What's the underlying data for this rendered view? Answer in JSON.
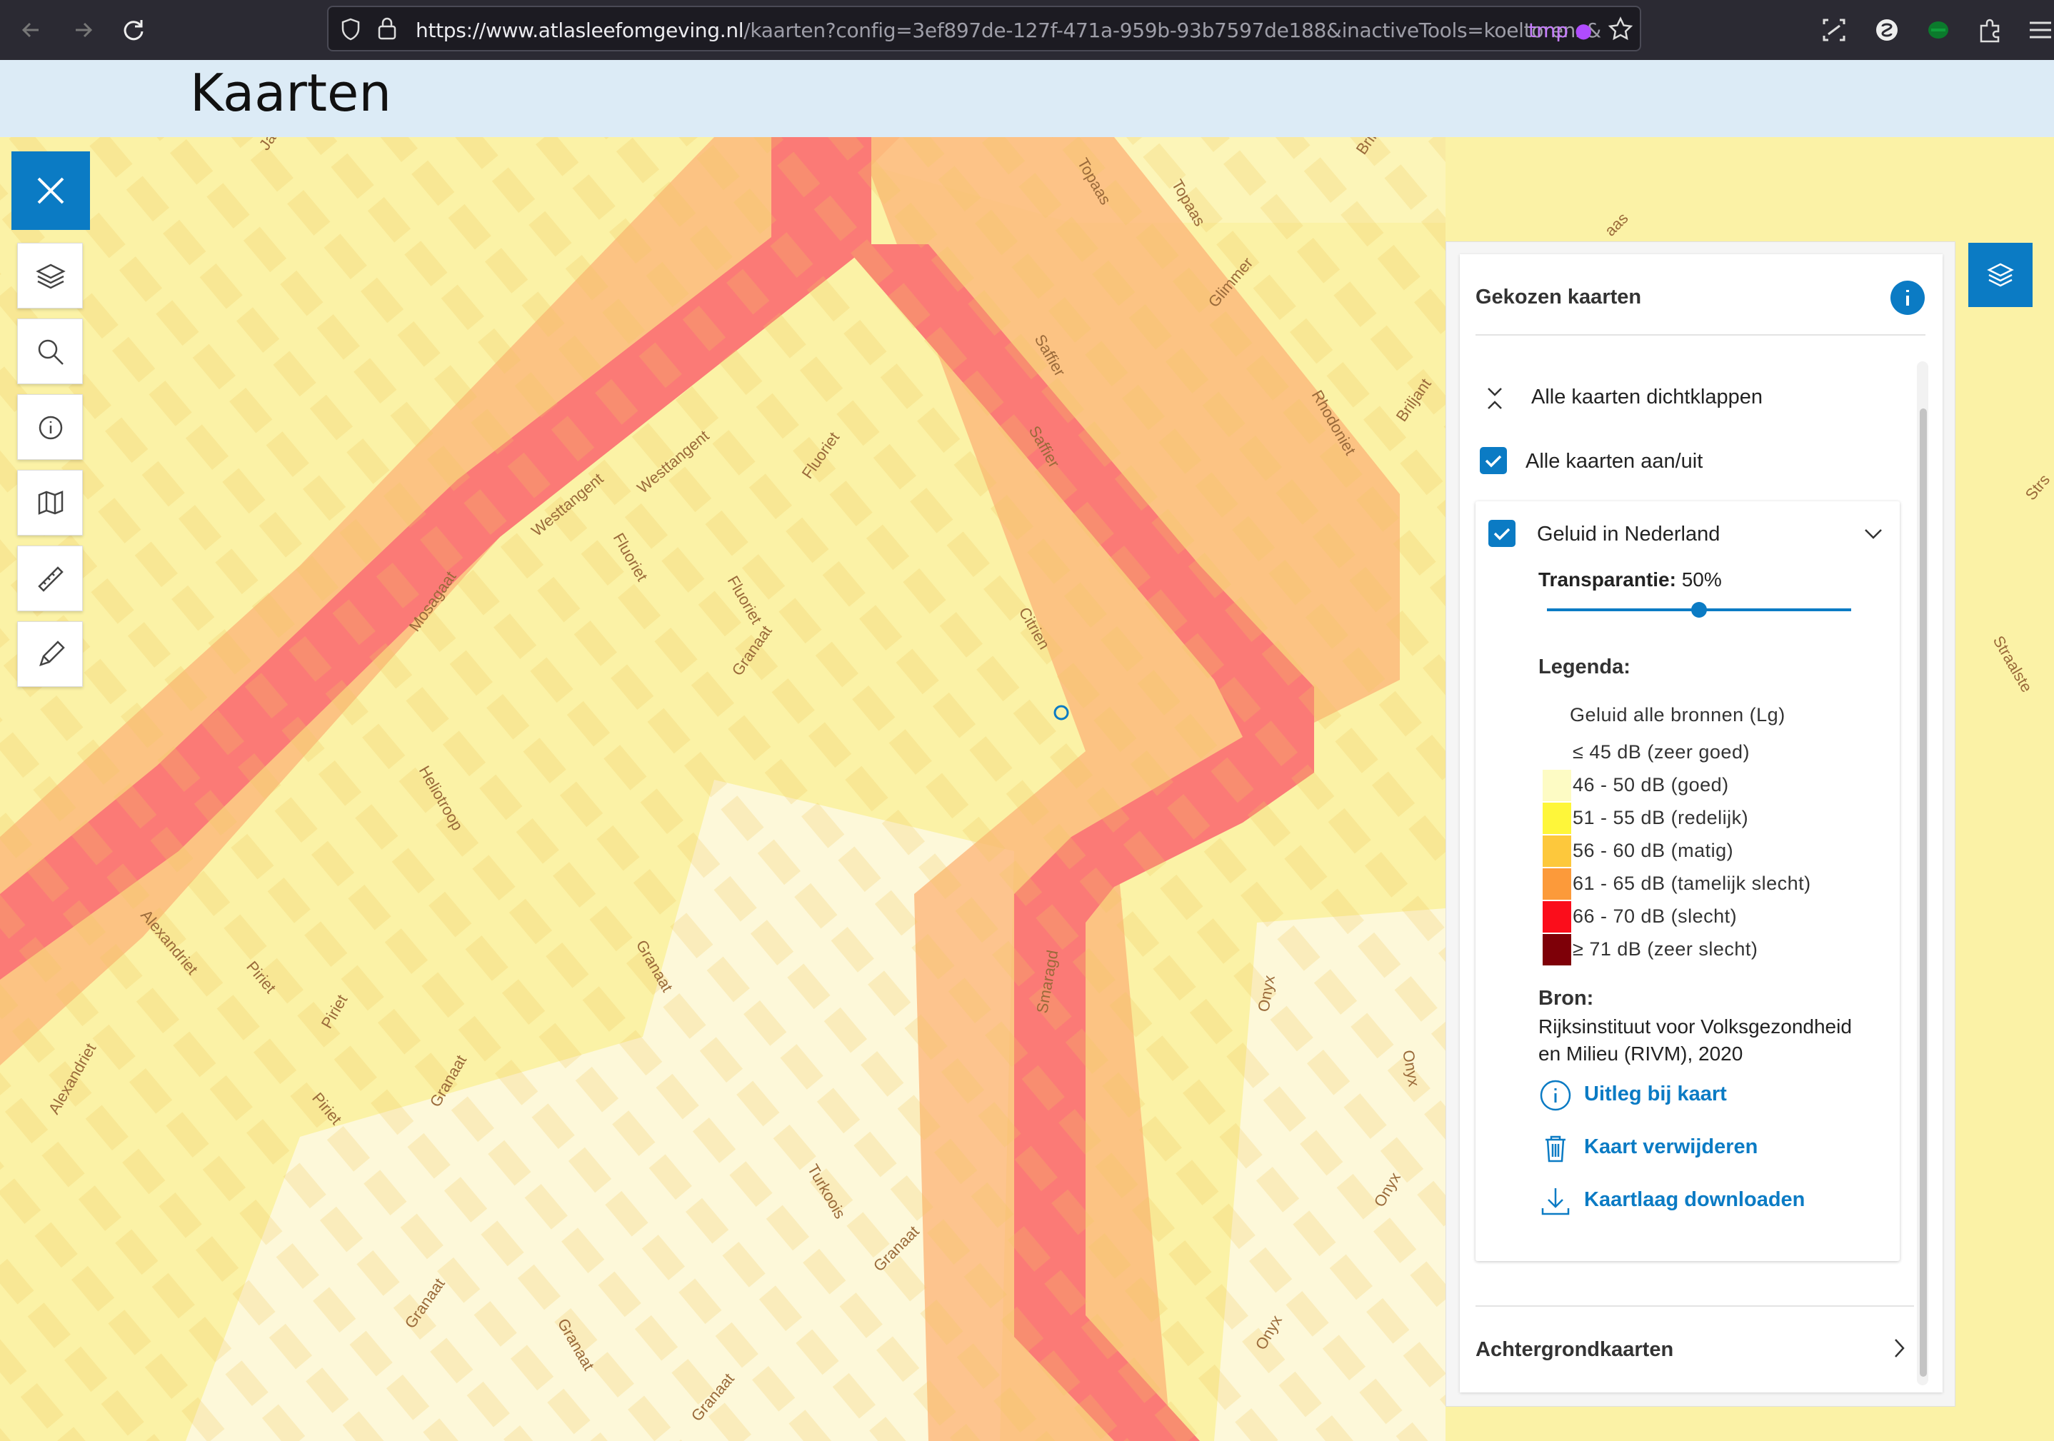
{
  "browser": {
    "url_domain": "https://www.atlasleefomgeving.nl",
    "url_path": "/kaarten?config=3ef897de-127f-471a-959b-93b7597de188&inactiveTools=koeltorens&",
    "tab_group": "tmp"
  },
  "header": {
    "title": "Kaarten"
  },
  "toolbar": {
    "tools": [
      "layers-icon",
      "search-icon",
      "info-icon",
      "map-book-icon",
      "ruler-icon",
      "pencil-icon"
    ]
  },
  "map": {
    "street_labels": [
      "Westtangent",
      "Westtangent",
      "Saffier",
      "Saffier",
      "Topaas",
      "Topaas",
      "Glimmer",
      "Rhodoniet",
      "Briljant",
      "Fluoriet",
      "Fluoriet",
      "Fluoriet",
      "Mosagaat",
      "Granaat",
      "Granaat",
      "Granaat",
      "Granaat",
      "Granaat",
      "Granaat",
      "Granaat",
      "Citrien",
      "Heliotroop",
      "Alexandriet",
      "Alexandriet",
      "Piriet",
      "Piriet",
      "Piriet",
      "Smaragd",
      "Onyx",
      "Onyx",
      "Onyx",
      "Onyx",
      "Turkoois",
      "Straalste",
      "Jan",
      "Strs",
      "Brill",
      "aas"
    ]
  },
  "panel": {
    "title": "Gekozen kaarten",
    "collapse_all": "Alle kaarten dichtklappen",
    "toggle_all": "Alle kaarten aan/uit",
    "layer": {
      "name": "Geluid in Nederland",
      "transparency_label": "Transparantie:",
      "transparency_value": "50%",
      "transparency_fraction": 0.5,
      "legend_label": "Legenda:",
      "legend_title": "Geluid alle bronnen (Lg)",
      "legend": [
        {
          "label": "≤ 45 dB (zeer goed)",
          "color": "#ffffff"
        },
        {
          "label": "46 - 50 dB (goed)",
          "color": "#fdfbc4"
        },
        {
          "label": "51 - 55 dB (redelijk)",
          "color": "#fef63a"
        },
        {
          "label": "56 - 60 dB (matig)",
          "color": "#fdc83c"
        },
        {
          "label": "61 - 65 dB (tamelijk slecht)",
          "color": "#fc9a3a"
        },
        {
          "label": "66 - 70 dB (slecht)",
          "color": "#fb0d1b"
        },
        {
          "label": "≥ 71 dB (zeer slecht)",
          "color": "#7e0008"
        }
      ],
      "source_label": "Bron:",
      "source_line1": "Rijksinstituut voor Volksgezondheid",
      "source_line2": "en Milieu (RIVM), 2020",
      "actions": [
        {
          "label": "Uitleg bij kaart",
          "icon": "info-circle-icon"
        },
        {
          "label": "Kaart verwijderen",
          "icon": "trash-icon"
        },
        {
          "label": "Kaartlaag downloaden",
          "icon": "download-icon"
        }
      ]
    },
    "background_maps": "Achtergrondkaarten"
  },
  "colors": {
    "accent": "#0b7bc4",
    "noise_red": "#fb7a76",
    "noise_orange": "#fcb77a",
    "noise_yellow": "#fbf2a6"
  }
}
